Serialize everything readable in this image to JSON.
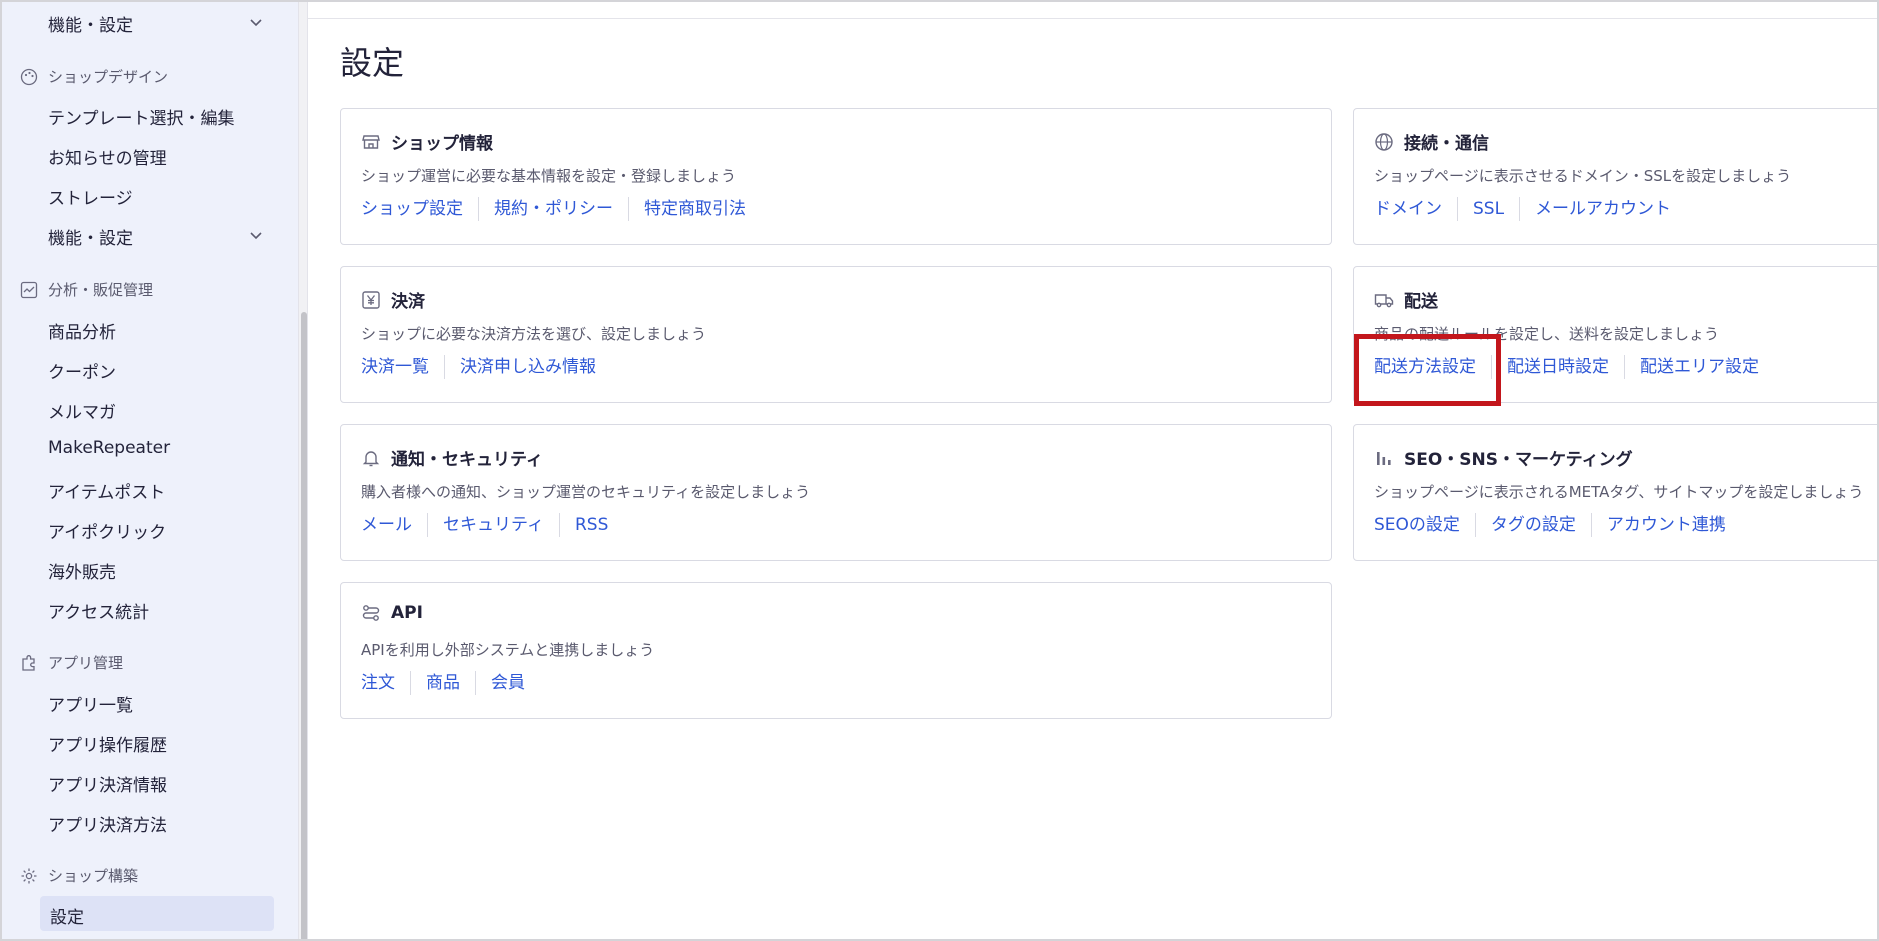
{
  "sidebar": {
    "top_item": "機能・設定",
    "sections": [
      {
        "label": "ショップデザイン",
        "icon": "palette-icon",
        "items": [
          "テンプレート選択・編集",
          "お知らせの管理",
          "ストレージ",
          "機能・設定"
        ]
      },
      {
        "label": "分析・販促管理",
        "icon": "chart-line-icon",
        "items": [
          "商品分析",
          "クーポン",
          "メルマガ",
          "MakeRepeater",
          "アイテムポスト",
          "アイポクリック",
          "海外販売",
          "アクセス統計"
        ]
      },
      {
        "label": "アプリ管理",
        "icon": "puzzle-icon",
        "items": [
          "アプリ一覧",
          "アプリ操作履歴",
          "アプリ決済情報",
          "アプリ決済方法"
        ]
      },
      {
        "label": "ショップ構築",
        "icon": "gear-icon",
        "items": [
          "設定"
        ]
      }
    ],
    "active_item": "設定"
  },
  "main": {
    "title": "設定",
    "cards": [
      {
        "title": "ショップ情報",
        "icon": "store-icon",
        "description": "ショップ運営に必要な基本情報を設定・登録しましょう",
        "links": [
          "ショップ設定",
          "規約・ポリシー",
          "特定商取引法"
        ]
      },
      {
        "title": "接続・通信",
        "icon": "globe-icon",
        "description": "ショップページに表示させるドメイン・SSLを設定しましょう",
        "links": [
          "ドメイン",
          "SSL",
          "メールアカウント"
        ]
      },
      {
        "title": "決済",
        "icon": "yen-icon",
        "description": "ショップに必要な決済方法を選び、設定しましょう",
        "links": [
          "決済一覧",
          "決済申し込み情報"
        ]
      },
      {
        "title": "配送",
        "icon": "truck-icon",
        "description": "商品の配送ルールを設定し、送料を設定しましょう",
        "links": [
          "配送方法設定",
          "配送日時設定",
          "配送エリア設定"
        ]
      },
      {
        "title": "通知・セキュリティ",
        "icon": "bell-icon",
        "description": "購入者様への通知、ショップ運営のセキュリティを設定しましょう",
        "links": [
          "メール",
          "セキュリティ",
          "RSS"
        ]
      },
      {
        "title": "SEO・SNS・マーケティング",
        "icon": "bar-chart-icon",
        "description": "ショップページに表示されるMETAタグ、サイトマップを設定しましょう",
        "links": [
          "SEOの設定",
          "タグの設定",
          "アカウント連携"
        ]
      },
      {
        "title": "API",
        "icon": "api-icon",
        "description": "APIを利用し外部システムと連携しましょう",
        "links": [
          "注文",
          "商品",
          "会員"
        ]
      }
    ]
  },
  "colors": {
    "sidebar_bg": "#eef1fb",
    "active_bg": "#dde2f6",
    "link": "#2f58d6",
    "highlight_border": "#c3161c",
    "card_border": "#d9dae3"
  }
}
